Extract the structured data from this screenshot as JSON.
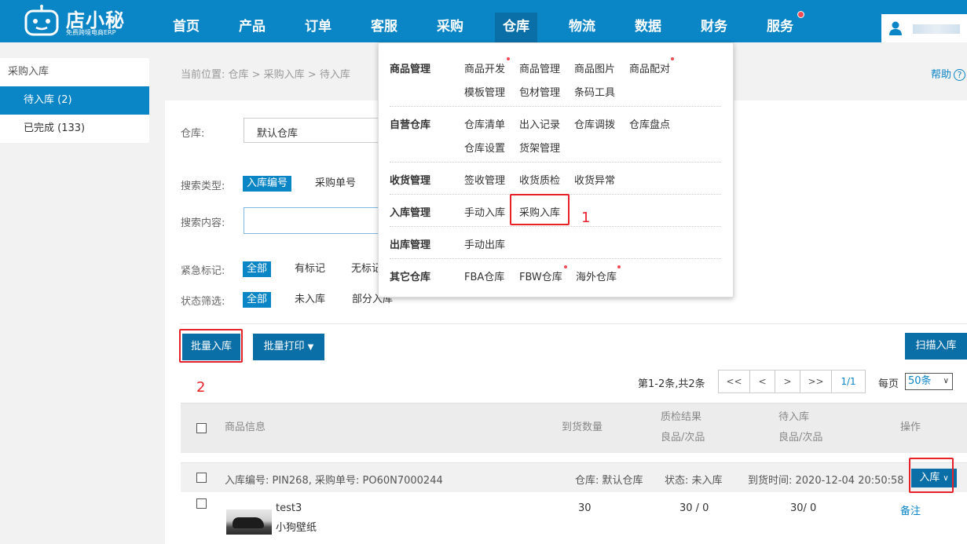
{
  "brand": {
    "name": "店小秘",
    "tagline": "免费跨境电商ERP"
  },
  "nav": {
    "items": [
      {
        "label": "首页"
      },
      {
        "label": "产品"
      },
      {
        "label": "订单"
      },
      {
        "label": "客服"
      },
      {
        "label": "采购"
      },
      {
        "label": "仓库"
      },
      {
        "label": "物流"
      },
      {
        "label": "数据"
      },
      {
        "label": "财务"
      },
      {
        "label": "服务"
      }
    ],
    "active": "仓库",
    "accent": "#0a85c6"
  },
  "sidebar": {
    "title": "采购入库",
    "items": [
      {
        "label": "待入库 (2)"
      },
      {
        "label": "已完成 (133)"
      }
    ]
  },
  "breadcrumb": {
    "text": "当前位置:  仓库 > 采购入库 > 待入库",
    "help": "帮助"
  },
  "filters": {
    "warehouse_label": "仓库:",
    "warehouse_value": "默认仓库",
    "search_type_label": "搜索类型:",
    "search_types": [
      "入库编号",
      "采购单号"
    ],
    "search_content_label": "搜索内容:",
    "search_value": "",
    "urgent_label": "紧急标记:",
    "urgent_options": [
      "全部",
      "有标记",
      "无标记"
    ],
    "status_label": "状态筛选:",
    "status_options": [
      "全部",
      "未入库",
      "部分入库"
    ]
  },
  "toolbar": {
    "batch_in": "批量入库",
    "batch_print": "批量打印",
    "scan_in": "扫描入库"
  },
  "pagination": {
    "info": "第1-2条,共2条",
    "buttons": [
      "<<",
      "<",
      ">",
      ">>",
      "1/1"
    ],
    "per_page_label": "每页",
    "per_page_value": "50条"
  },
  "table": {
    "headers": {
      "product": "商品信息",
      "arrival_qty": "到货数量",
      "qc_title": "质检结果",
      "qc_sub": "良品/次品",
      "pending_title": "待入库",
      "pending_sub": "良品/次品",
      "action": "操作"
    },
    "group": {
      "ids": "入库编号: PIN268, 采购单号: PO60N7000244",
      "warehouse": "仓库: 默认仓库",
      "status": "状态:  未入库",
      "arrival_time": "到货时间: 2020-12-04 20:50:58",
      "in_button": "入库"
    },
    "rows": [
      {
        "sku": "test3",
        "name": "小狗壁纸",
        "arrival_qty": "30",
        "qc": "30 / 0",
        "pending": "30/ 0",
        "action": "备注"
      }
    ]
  },
  "dropdown": {
    "sections": [
      {
        "title": "商品管理",
        "items": [
          "商品开发",
          "商品管理",
          "商品图片",
          "商品配对",
          "模板管理",
          "包材管理",
          "条码工具"
        ]
      },
      {
        "title": "自营仓库",
        "items": [
          "仓库清单",
          "出入记录",
          "仓库调拨",
          "仓库盘点",
          "仓库设置",
          "货架管理"
        ]
      },
      {
        "title": "收货管理",
        "items": [
          "签收管理",
          "收货质检",
          "收货异常"
        ]
      },
      {
        "title": "入库管理",
        "items": [
          "手动入库",
          "采购入库"
        ]
      },
      {
        "title": "出库管理",
        "items": [
          "手动出库"
        ]
      },
      {
        "title": "其它仓库",
        "items": [
          "FBA仓库",
          "FBW仓库",
          "海外仓库"
        ]
      }
    ]
  },
  "annotations": {
    "step1": "1",
    "step2": "2",
    "highlight_color": "#e8202a"
  }
}
